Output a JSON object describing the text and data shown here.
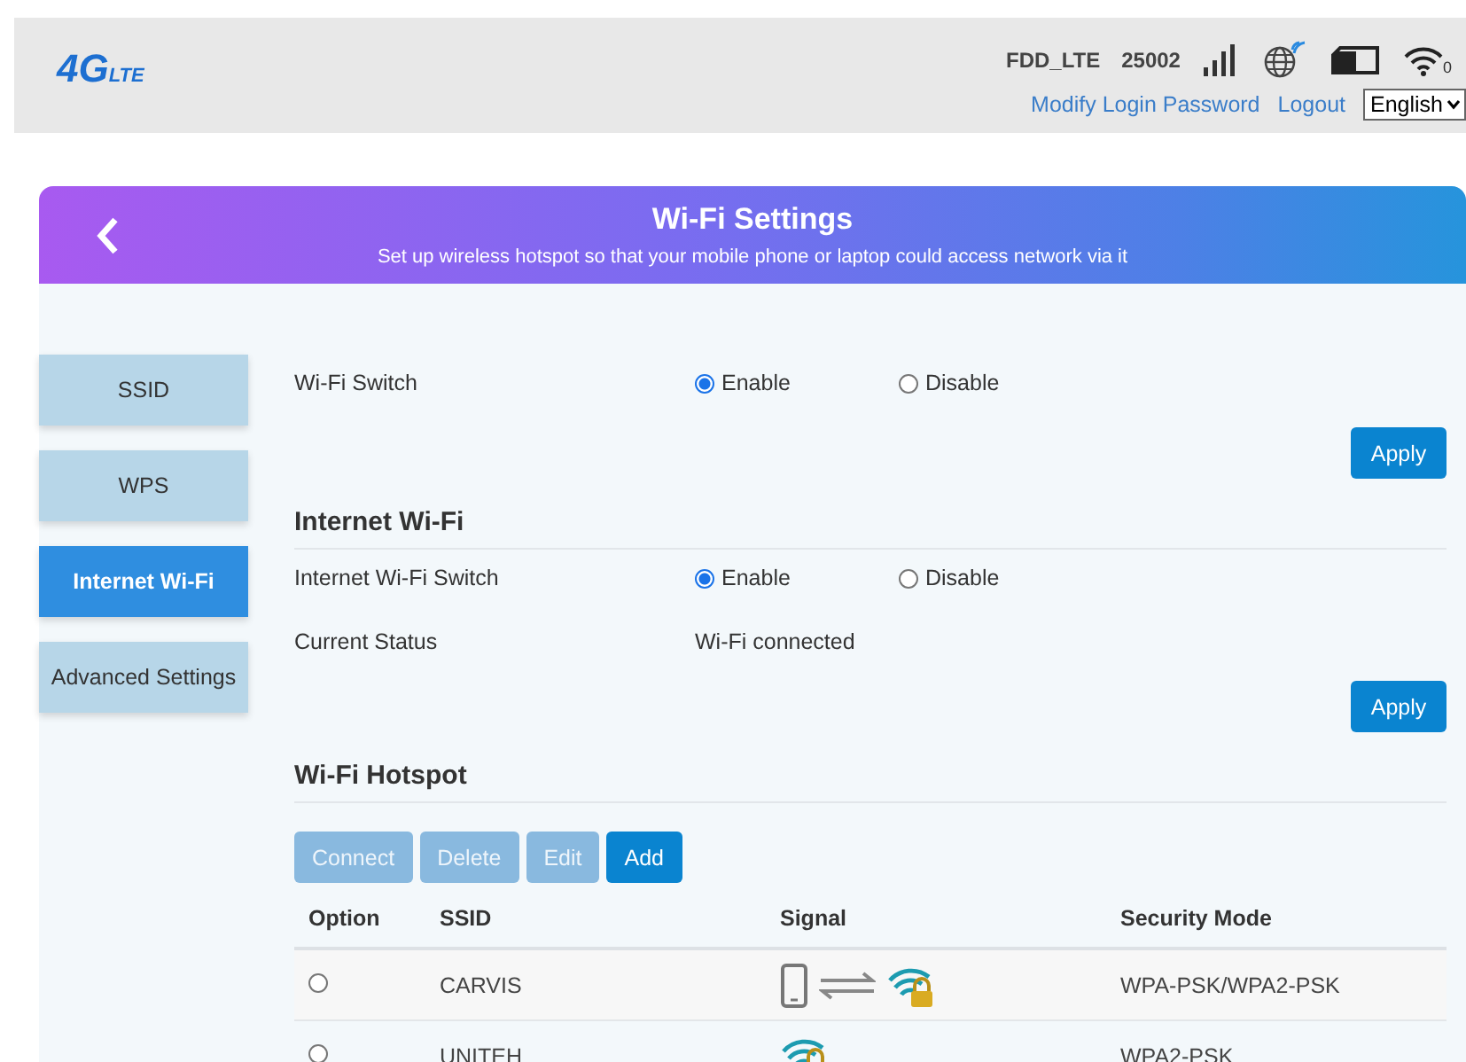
{
  "header": {
    "logo": {
      "main": "4G",
      "sub": "LTE"
    },
    "network": "FDD_LTE",
    "code": "25002",
    "wifi_clients": "0",
    "links": [
      "Modify Login Password",
      "Logout"
    ],
    "language": "English"
  },
  "page": {
    "title": "Wi-Fi Settings",
    "subtitle": "Set up wireless hotspot so that your mobile phone or laptop could access network via it"
  },
  "sidebar": [
    {
      "label": "SSID",
      "selected": false
    },
    {
      "label": "WPS",
      "selected": false
    },
    {
      "label": "Internet Wi-Fi",
      "selected": true
    },
    {
      "label": "Advanced Settings",
      "selected": false
    }
  ],
  "wifi_switch": {
    "label": "Wi-Fi Switch",
    "options": [
      {
        "label": "Enable",
        "selected": true
      },
      {
        "label": "Disable",
        "selected": false
      }
    ],
    "apply": "Apply"
  },
  "internet_wifi": {
    "heading": "Internet Wi-Fi",
    "switch_label": "Internet Wi-Fi Switch",
    "options": [
      {
        "label": "Enable",
        "selected": true
      },
      {
        "label": "Disable",
        "selected": false
      }
    ],
    "status_label": "Current Status",
    "status": "Wi-Fi connected",
    "apply": "Apply"
  },
  "hotspot": {
    "heading": "Wi-Fi Hotspot",
    "buttons": [
      {
        "label": "Connect",
        "disabled": true
      },
      {
        "label": "Delete",
        "disabled": true
      },
      {
        "label": "Edit",
        "disabled": true
      },
      {
        "label": "Add",
        "disabled": false
      }
    ],
    "columns": [
      "Option",
      "SSID",
      "Signal",
      "Security Mode"
    ],
    "rows": [
      {
        "selected": false,
        "ssid": "CARVIS",
        "connected": true,
        "security": "WPA-PSK/WPA2-PSK"
      },
      {
        "selected": false,
        "ssid": "UNITEH",
        "connected": false,
        "security": "WPA2-PSK"
      }
    ]
  }
}
